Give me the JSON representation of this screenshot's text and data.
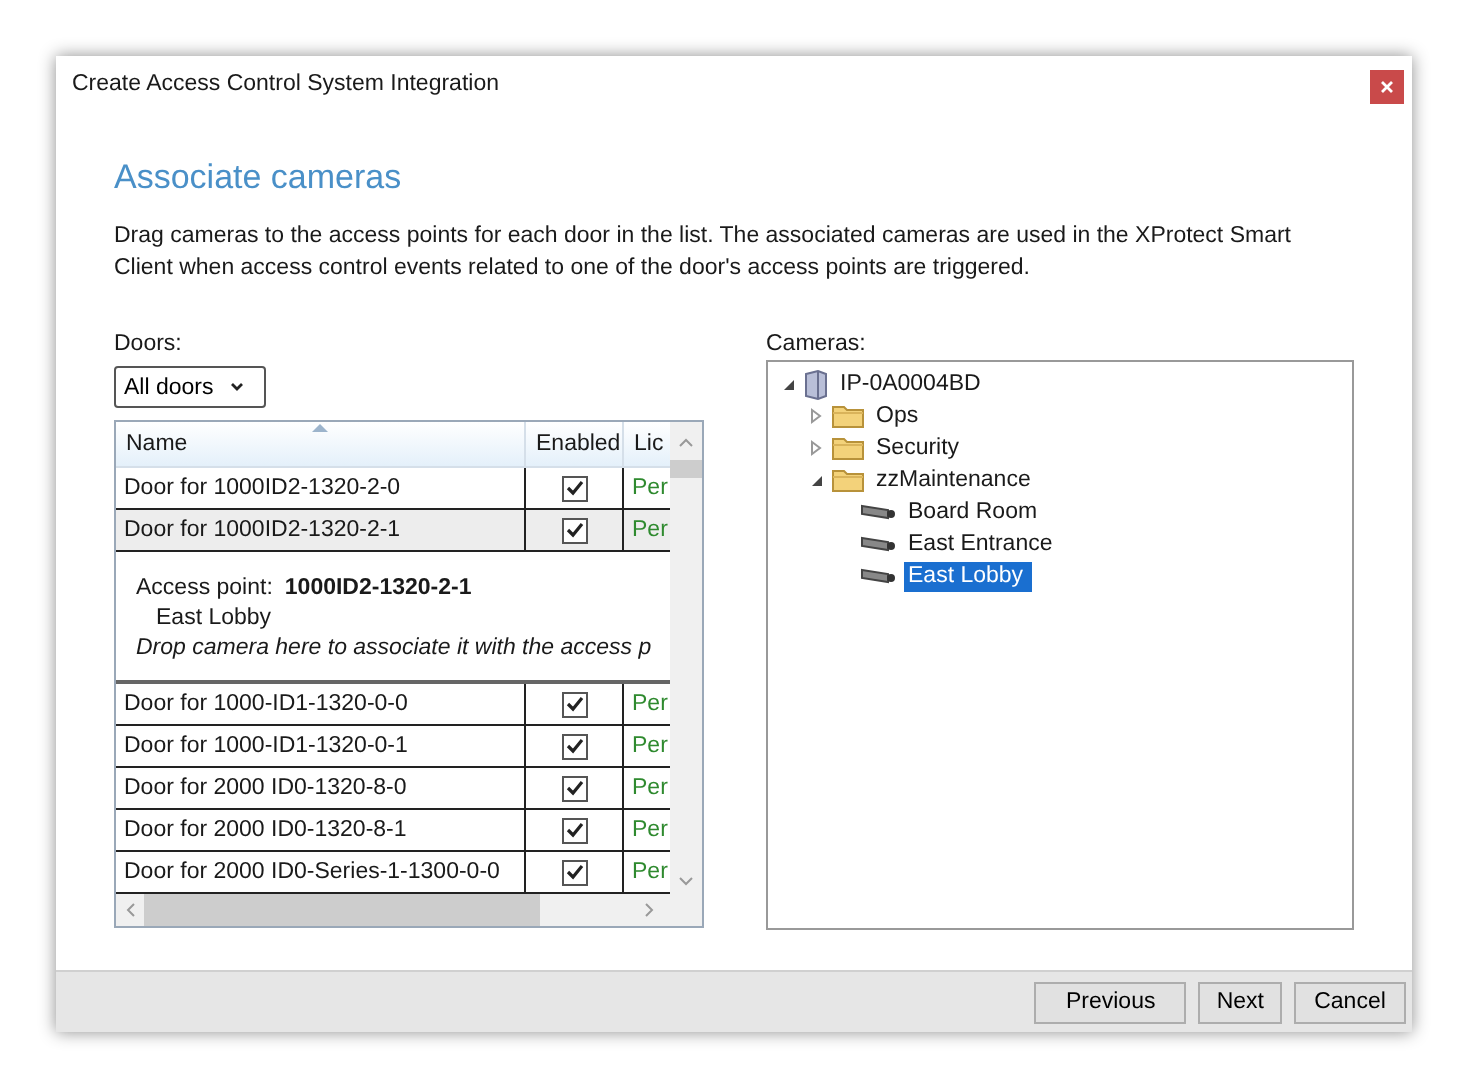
{
  "window": {
    "title": "Create Access Control System Integration"
  },
  "heading": "Associate cameras",
  "description": "Drag cameras to the access points for each door in the list. The associated cameras are used in the XProtect Smart Client when access control events related to one of the door's access points are triggered.",
  "doors": {
    "label": "Doors:",
    "filter": "All doors",
    "columns": [
      {
        "label": "Name",
        "sorted": true
      },
      {
        "label": "Enabled",
        "sorted": false
      },
      {
        "label": "Lic",
        "sorted": false
      }
    ],
    "rows": [
      {
        "name": "Door for 1000ID2-1320-2-0",
        "enabled": true,
        "license": "Per",
        "selected": false,
        "expanded": false
      },
      {
        "name": "Door for 1000ID2-1320-2-1",
        "enabled": true,
        "license": "Per",
        "selected": true,
        "expanded": true,
        "detail": {
          "label": "Access point:",
          "access_point": "1000ID2-1320-2-1",
          "camera": "East Lobby",
          "hint": "Drop camera here to associate it with the access p"
        }
      },
      {
        "name": "Door for 1000-ID1-1320-0-0",
        "enabled": true,
        "license": "Per",
        "selected": false,
        "expanded": false
      },
      {
        "name": "Door for 1000-ID1-1320-0-1",
        "enabled": true,
        "license": "Per",
        "selected": false,
        "expanded": false
      },
      {
        "name": "Door for 2000 ID0-1320-8-0",
        "enabled": true,
        "license": "Per",
        "selected": false,
        "expanded": false
      },
      {
        "name": "Door for 2000 ID0-1320-8-1",
        "enabled": true,
        "license": "Per",
        "selected": false,
        "expanded": false
      },
      {
        "name": "Door for 2000 ID0-Series-1-1300-0-0",
        "enabled": true,
        "license": "Per",
        "selected": false,
        "expanded": false
      }
    ]
  },
  "cameras": {
    "label": "Cameras:",
    "tree": [
      {
        "kind": "server",
        "label": "IP-0A0004BD",
        "expanded": true,
        "selected": false,
        "children": [
          {
            "kind": "folder",
            "label": "Ops",
            "expanded": false,
            "selected": false
          },
          {
            "kind": "folder",
            "label": "Security",
            "expanded": false,
            "selected": false
          },
          {
            "kind": "folder",
            "label": "zzMaintenance",
            "expanded": true,
            "selected": false,
            "children": [
              {
                "kind": "camera",
                "label": "Board Room",
                "selected": false
              },
              {
                "kind": "camera",
                "label": "East Entrance",
                "selected": false
              },
              {
                "kind": "camera",
                "label": "East Lobby",
                "selected": true
              }
            ]
          }
        ]
      }
    ]
  },
  "buttons": [
    "Previous",
    "Next",
    "Cancel"
  ]
}
